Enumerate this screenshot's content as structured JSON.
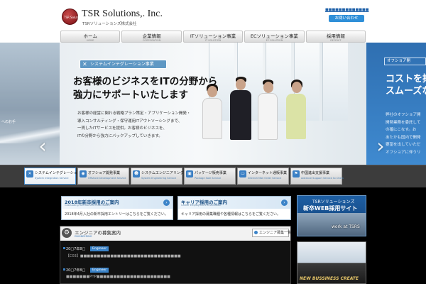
{
  "header": {
    "logo_mark_text": "TSR Solutions",
    "company_name": "TSR Solutions,. Inc.",
    "company_name_kana": "TSRソリューションズ株式会社",
    "top_link": "■■■■■■■■■■■■■",
    "contact_label": "お問い合わせ"
  },
  "nav": [
    {
      "label": "ホーム",
      "sub": "HOME"
    },
    {
      "label": "企業情報",
      "sub": "CORPORATION"
    },
    {
      "label": "ITソリューション事業",
      "sub": "IT SOLUTION"
    },
    {
      "label": "ECソリューション事業",
      "sub": "EC SOLUTION"
    },
    {
      "label": "採用情報",
      "sub": "RECRUIT"
    }
  ],
  "hero": {
    "left_caption": "へのお手",
    "badge": "システムインテグレーション事業",
    "headline_1": "お客様のビジネスをITの分野から",
    "headline_2": "強力にサポートいたします",
    "body_1": "お客様の経営に関わる戦略プラン策定・アプリケーション開発・",
    "body_2": "導入コンサルティング・保守運用ITアウトソーシングまで、",
    "body_3": "一貫したITサービスを提供。お客様のビジネスを、",
    "body_4": "ITの分野から強力にバックアップしていきます。",
    "right_tag": "オフショア開",
    "right_big_1": "コストを抑",
    "right_big_2": "スムーズな",
    "right_small_1": "弊社のオフショア開",
    "right_small_2": "開発業務を委託して",
    "right_small_3": "の確にこなす。お",
    "right_small_4": "あたかも国内で開発",
    "right_small_5": "要望を出していただ",
    "right_small_6": "オフショアに伴うリ"
  },
  "services": [
    {
      "label": "システムインテグレーション事業",
      "sub": "System Integration Service",
      "icon": "wrench-icon",
      "glyph": "✕"
    },
    {
      "label": "オフショア開発事業",
      "sub": "Offshore Development Service",
      "icon": "globe-icon",
      "glyph": "◉"
    },
    {
      "label": "システムエンジニアリング事業",
      "sub": "System Engineering Service",
      "icon": "people-icon",
      "glyph": "☻"
    },
    {
      "label": "パッケージ販売事業",
      "sub": "Package Sale Service",
      "icon": "package-icon",
      "glyph": "▣"
    },
    {
      "label": "インターネット通販事業",
      "sub": "Internet Mail Order Service",
      "icon": "monitor-icon",
      "glyph": "▭"
    },
    {
      "label": "中国進出支援事業",
      "sub": "Advance Support Service to China",
      "icon": "flag-icon",
      "glyph": "⚑"
    }
  ],
  "recruit": [
    {
      "title": "2018年新卒採用のご案内",
      "sub": "Graduating Recruitment Information",
      "desc": "2018年4月入社の新卒採用エントリーはこちらをご覧ください。"
    },
    {
      "title": "キャリア採用のご案内",
      "sub": "Career Employment Information",
      "desc": "キャリア採用の募集職種や各種情報はこちらをご覧ください。"
    }
  ],
  "engineer": {
    "title": "エンジニアの募集案内",
    "sub": "ENGINEERING",
    "list_button": "エンジニア募集一覧",
    "posts": [
      {
        "date": "20□7年8□",
        "tag": "Engineer",
        "text": "【C03】■■■■■■■■■■■■■■■■■■■■■■■■■■■■■■"
      },
      {
        "date": "20□7年8□",
        "tag": "Engineer",
        "text": "■■■■■■■PHP■■■■■■■■■■■■■■■■■■■■■■"
      }
    ]
  },
  "side": {
    "banner_top": "TSRソリューションズ",
    "banner_big": "新卒WEB採用サイト",
    "banner_work": "work at TSRS",
    "banner2": "NEW BUSSINESS CREATE"
  }
}
